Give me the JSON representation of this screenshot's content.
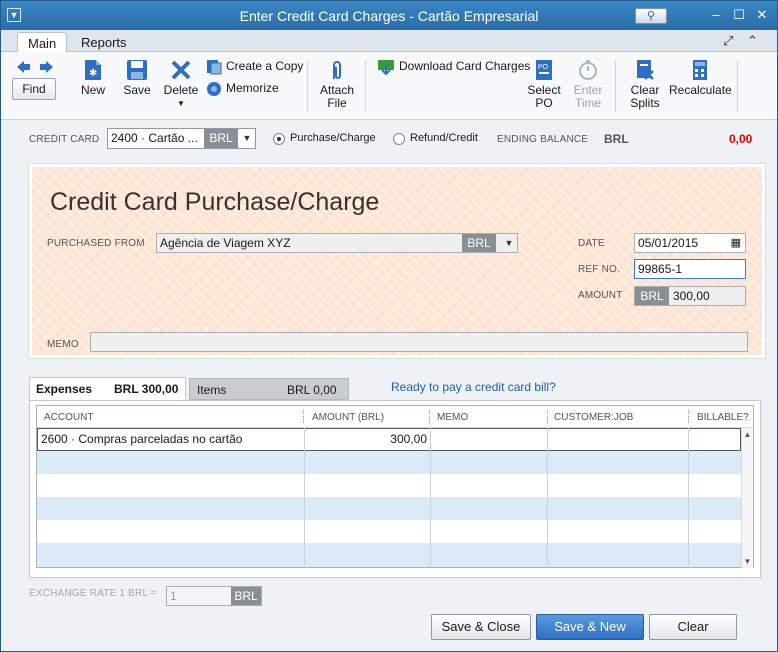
{
  "window": {
    "title": "Enter Credit Card Charges - Cartão Empresarial"
  },
  "tabs": {
    "main": "Main",
    "reports": "Reports"
  },
  "toolbar": {
    "find": "Find",
    "new": "New",
    "save": "Save",
    "delete": "Delete",
    "create_copy": "Create a Copy",
    "memorize": "Memorize",
    "attach_line1": "Attach",
    "attach_line2": "File",
    "download_card_charges": "Download Card Charges",
    "select_line1": "Select",
    "select_line2": "PO",
    "enter_line1": "Enter",
    "enter_line2": "Time",
    "clear_line1": "Clear",
    "clear_line2": "Splits",
    "recalculate": "Recalculate"
  },
  "credit_card": {
    "label": "CREDIT CARD",
    "account": "2400 · Cartão ...",
    "currency": "BRL",
    "purchase_label": "Purchase/Charge",
    "refund_label": "Refund/Credit",
    "selected": "Purchase/Charge",
    "ending_balance_label": "ENDING BALANCE",
    "ending_balance_currency": "BRL",
    "ending_balance_value": "0,00",
    "ending_balance_color": "#e00000"
  },
  "form": {
    "title": "Credit Card Purchase/Charge",
    "purchased_from_label": "PURCHASED FROM",
    "purchased_from_value": "Agência de Viagem XYZ",
    "purchased_from_currency": "BRL",
    "date_label": "DATE",
    "date_value": "05/01/2015",
    "ref_label": "REF NO.",
    "ref_value": "99865-1",
    "amount_label": "AMOUNT",
    "amount_currency": "BRL",
    "amount_value": "300,00",
    "memo_label": "MEMO",
    "memo_value": ""
  },
  "expense_tabs": {
    "expenses_label": "Expenses",
    "expenses_total": "BRL  300,00",
    "items_label": "Items",
    "items_total": "BRL  0,00",
    "ready_link": "Ready to pay a credit card bill?"
  },
  "grid": {
    "headers": [
      "ACCOUNT",
      "AMOUNT (BRL)",
      "MEMO",
      "CUSTOMER:JOB",
      "BILLABLE?"
    ],
    "rows": [
      {
        "account": "2600 · Compras parceladas no cartão",
        "amount": "300,00",
        "memo": "",
        "customer": "",
        "billable": ""
      }
    ]
  },
  "footer": {
    "exchange_label": "EXCHANGE RATE 1 BRL =",
    "exchange_value": "1",
    "exchange_currency": "BRL",
    "save_close": "Save & Close",
    "save_new": "Save & New",
    "clear": "Clear"
  }
}
